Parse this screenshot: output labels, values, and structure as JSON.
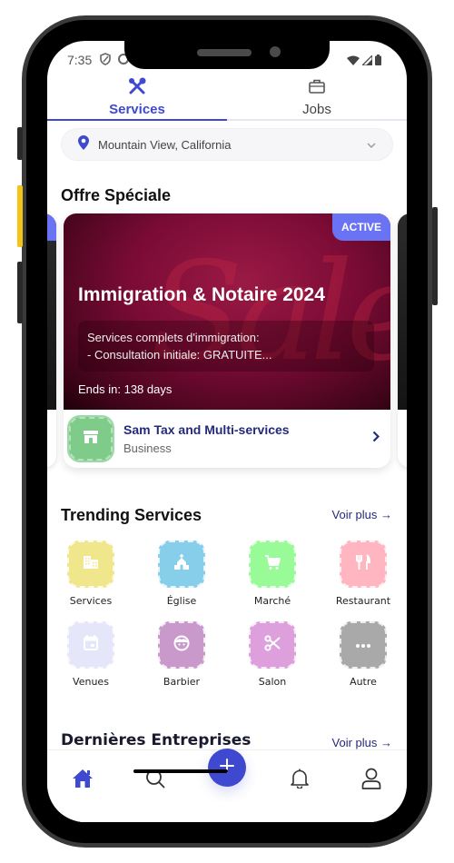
{
  "status_bar": {
    "time": "7:35"
  },
  "tabs": [
    {
      "label": "Services",
      "icon": "tools-icon",
      "active": true
    },
    {
      "label": "Jobs",
      "icon": "briefcase-icon",
      "active": false
    }
  ],
  "location": {
    "value": "Mountain View, California",
    "icon": "map-pin-icon"
  },
  "special_offer": {
    "section_title": "Offre Spéciale",
    "card": {
      "badge": "ACTIVE",
      "title": "Immigration & Notaire 2024",
      "description_line1": "Services complets d'immigration:",
      "description_line2": "- Consultation initiale: GRATUITE...",
      "ends_in": "Ends in: 138 days",
      "business_name": "Sam Tax and Multi-services",
      "business_type": "Business",
      "decoration_text": "Sale"
    }
  },
  "trending": {
    "section_title": "Trending Services",
    "see_more": "Voir plus →",
    "categories": [
      {
        "label": "Services",
        "icon": "building-icon",
        "color": "#f0e68c"
      },
      {
        "label": "Église",
        "icon": "church-icon",
        "color": "#87ceeb"
      },
      {
        "label": "Marché",
        "icon": "cart-icon",
        "color": "#98fb98"
      },
      {
        "label": "Restaurant",
        "icon": "utensils-icon",
        "color": "#ffb6c1"
      },
      {
        "label": "Venues",
        "icon": "calendar-icon",
        "color": "#e6e6fa"
      },
      {
        "label": "Barbier",
        "icon": "face-icon",
        "color": "#c999cb"
      },
      {
        "label": "Salon",
        "icon": "scissors-icon",
        "color": "#dda0dd"
      },
      {
        "label": "Autre",
        "icon": "more-icon",
        "color": "#a9a9a9"
      }
    ]
  },
  "latest": {
    "section_title": "Dernières Entreprises",
    "see_more": "Voir plus →"
  },
  "bottom_nav": [
    {
      "name": "home",
      "icon": "home-icon",
      "active": true
    },
    {
      "name": "search",
      "icon": "search-icon",
      "active": false
    },
    {
      "name": "add",
      "icon": "plus-icon",
      "active": false
    },
    {
      "name": "notifications",
      "icon": "bell-icon",
      "active": false
    },
    {
      "name": "profile",
      "icon": "user-icon",
      "active": false
    }
  ],
  "colors": {
    "primary": "#3f49cf",
    "badge": "#6b73f5",
    "link": "#232a7a"
  }
}
